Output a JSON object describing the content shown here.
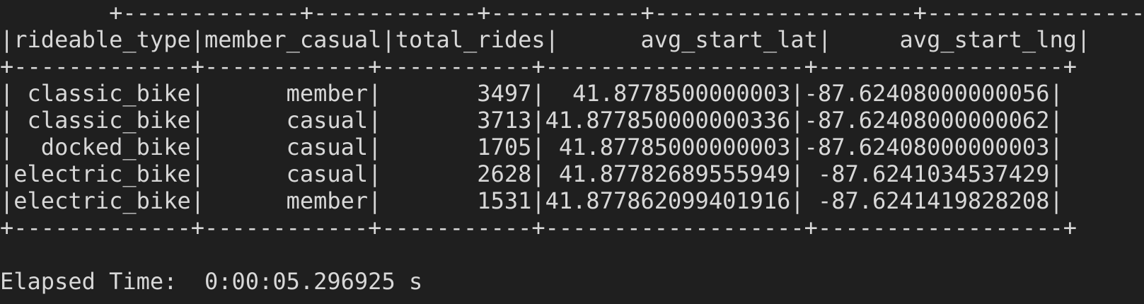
{
  "terminal": {
    "lines": [
      "        +-------------+------------+-----------+-------------------+------------------+",
      "|rideable_type|member_casual|total_rides|      avg_start_lat|     avg_start_lng|",
      "+-------------+------------+-----------+-------------------+------------------+",
      "| classic_bike|      member|       3497|  41.8778500000003|-87.62408000000056|",
      "| classic_bike|      casual|       3713|41.877850000000336|-87.62408000000062|",
      "|  docked_bike|      casual|       1705| 41.87785000000003|-87.62408000000003|",
      "|electric_bike|      casual|       2628| 41.87782689555949| -87.6241034537429|",
      "|electric_bike|      member|       1531|41.877862099401916| -87.6241419828208|",
      "+-------------+------------+-----------+-------------------+------------------+",
      "",
      "Elapsed Time:  0:00:05.296925 s"
    ]
  },
  "table": {
    "headers": [
      "rideable_type",
      "member_casual",
      "total_rides",
      "avg_start_lat",
      "avg_start_lng"
    ],
    "rows": [
      [
        "classic_bike",
        "member",
        "3497",
        "41.8778500000003",
        "-87.62408000000056"
      ],
      [
        "classic_bike",
        "casual",
        "3713",
        "41.877850000000336",
        "-87.62408000000062"
      ],
      [
        "docked_bike",
        "casual",
        "1705",
        "41.87785000000003",
        "-87.62408000000003"
      ],
      [
        "electric_bike",
        "casual",
        "2628",
        "41.87782689555949",
        "-87.6241034537429"
      ],
      [
        "electric_bike",
        "member",
        "1531",
        "41.877862099401916",
        "-87.6241419828208"
      ]
    ]
  },
  "status": {
    "elapsed_time": "Elapsed Time:  0:00:05.296925 s"
  },
  "colors": {
    "background": "#1f1f1f",
    "text": "#d8d8d8"
  }
}
